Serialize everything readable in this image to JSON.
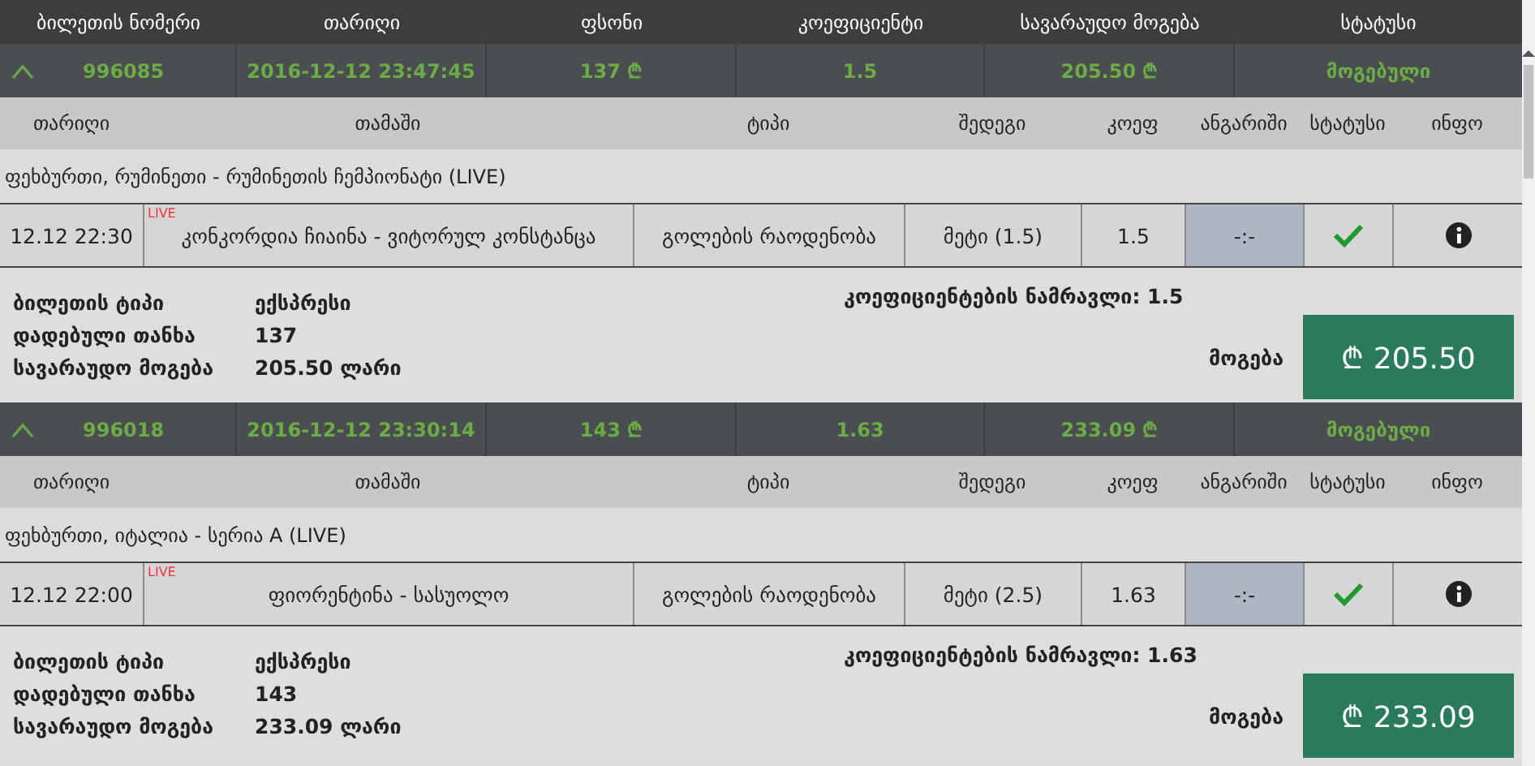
{
  "columns": [
    "ბილეთის ნომერი",
    "თარიღი",
    "ფსონი",
    "კოეფიციენტი",
    "სავარაუდო მოგება",
    "სტატუსი"
  ],
  "tickets": [
    {
      "expanded": true,
      "number": "996085",
      "date": "2016-12-12 23:47:45",
      "stake": "137 ₾",
      "odds": "1.5",
      "potential": "205.50 ₾",
      "status": "მოგებული",
      "bet_columns": [
        "თარიღი",
        "თამაში",
        "ტიპი",
        "შედეგი",
        "კოეფ",
        "ანგარიში",
        "სტატუსი",
        "ინფო"
      ],
      "league": "ფეხბურთი, რუმინეთი - რუმინეთის ჩემპიონატი (LIVE)",
      "bets": [
        {
          "time": "12.12 22:30",
          "live": true,
          "live_label": "LIVE",
          "match": "კონკორდია ჩიაინა - ვიტორულ კონსტანცა",
          "market": "გოლების რაოდენობა",
          "pick": "მეტი (1.5)",
          "odds": "1.5",
          "score": "-:-",
          "won": true
        }
      ],
      "summary": [
        {
          "label": "ბილეთის ტიპი",
          "value": "ექსპრესი"
        },
        {
          "label": "დადებული თანხა",
          "value": "137"
        },
        {
          "label": "სავარაუდო მოგება",
          "value": "205.50 ლარი"
        }
      ],
      "total_odds": "კოეფიციენტების ნამრავლი: 1.5",
      "win_label": "მოგება",
      "win_amount": "₾ 205.50"
    },
    {
      "expanded": true,
      "number": "996018",
      "date": "2016-12-12 23:30:14",
      "stake": "143 ₾",
      "odds": "1.63",
      "potential": "233.09 ₾",
      "status": "მოგებული",
      "bet_columns": [
        "თარიღი",
        "თამაში",
        "ტიპი",
        "შედეგი",
        "კოეფ",
        "ანგარიში",
        "სტატუსი",
        "ინფო"
      ],
      "league": "ფეხბურთი, იტალია - სერია A (LIVE)",
      "bets": [
        {
          "time": "12.12 22:00",
          "live": true,
          "live_label": "LIVE",
          "match": "ფიორენტინა - სასუოლო",
          "market": "გოლების რაოდენობა",
          "pick": "მეტი (2.5)",
          "odds": "1.63",
          "score": "-:-",
          "won": true
        }
      ],
      "summary": [
        {
          "label": "ბილეთის ტიპი",
          "value": "ექსპრესი"
        },
        {
          "label": "დადებული თანხა",
          "value": "143"
        },
        {
          "label": "სავარაუდო მოგება",
          "value": "233.09 ლარი"
        }
      ],
      "total_odds": "კოეფიციენტების ნამრავლი: 1.63",
      "win_label": "მოგება",
      "win_amount": "₾ 233.09"
    }
  ]
}
